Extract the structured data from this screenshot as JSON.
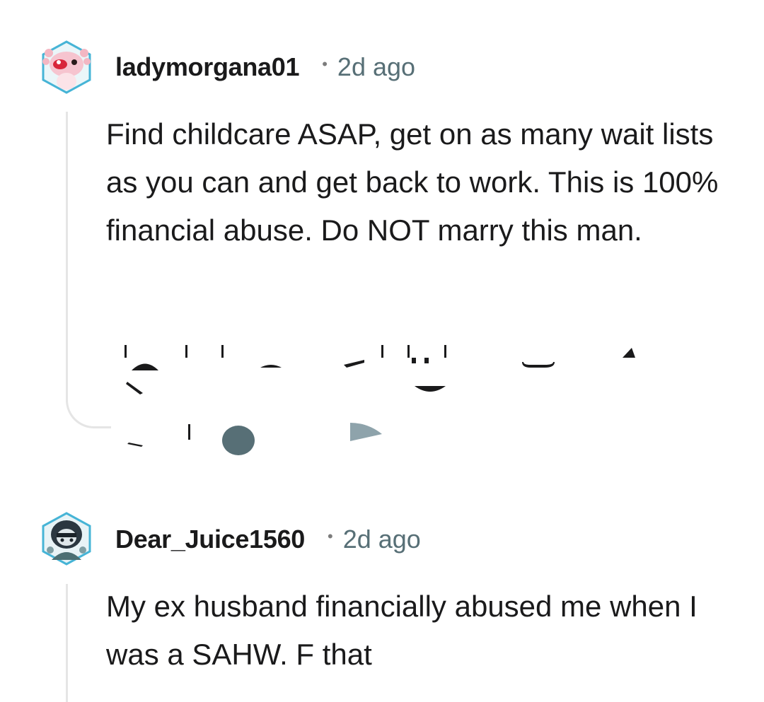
{
  "comments": [
    {
      "username": "ladymorgana01",
      "separator": "•",
      "time": "2d ago",
      "avatar_icon": "axolotl-avatar-icon",
      "body": "Find childcare ASAP, get on as many wait lists as you can and get back to work. This is 100% financial abuse. Do NOT marry this man."
    },
    {
      "username": "Dear_Juice1560",
      "separator": "•",
      "time": "2d ago",
      "avatar_icon": "hooded-snoo-avatar-icon",
      "body": "My ex husband financially abused me when I was a SAHW. F that"
    }
  ],
  "colors": {
    "text": "#1a1a1b",
    "meta": "#576f76",
    "thread": "#e5e5e5",
    "avatar_border": "#46d1e0"
  }
}
